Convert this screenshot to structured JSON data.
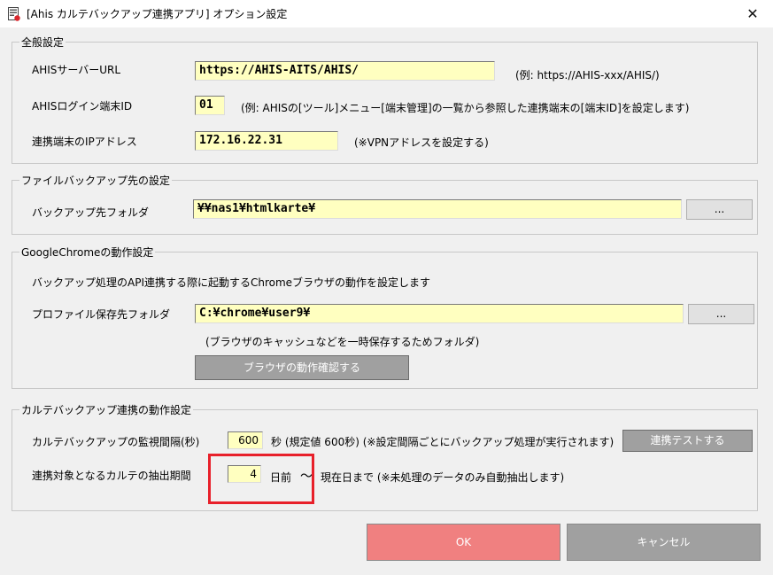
{
  "window": {
    "title": "[Ahis カルテバックアップ連携アプリ] オプション設定",
    "close_glyph": "✕"
  },
  "general": {
    "legend": "全般設定",
    "server_url_label": "AHISサーバーURL",
    "server_url_value": "https://AHIS-AITS/AHIS/",
    "server_url_hint": "(例: https://AHIS-xxx/AHIS/)",
    "terminal_id_label": "AHISログイン端末ID",
    "terminal_id_value": "01",
    "terminal_id_hint": "(例: AHISの[ツール]メニュー[端末管理]の一覧から参照した連携端末の[端末ID]を設定します)",
    "ip_label": "連携端末のIPアドレス",
    "ip_value": "172.16.22.31",
    "ip_hint": "(※VPNアドレスを設定する)"
  },
  "backup": {
    "legend": "ファイルバックアップ先の設定",
    "folder_label": "バックアップ先フォルダ",
    "folder_value": "¥¥nas1¥htmlkarte¥",
    "browse_label": "..."
  },
  "chrome": {
    "legend": "GoogleChromeの動作設定",
    "description": "バックアップ処理のAPI連携する際に起動するChromeブラウザの動作を設定します",
    "profile_label": "プロファイル保存先フォルダ",
    "profile_value": "C:¥chrome¥user9¥",
    "browse_label": "...",
    "profile_hint": "(ブラウザのキャッシュなどを一時保存するためフォルダ)",
    "check_button": "ブラウザの動作確認する"
  },
  "sync": {
    "legend": "カルテバックアップ連携の動作設定",
    "interval_label": "カルテバックアップの監視間隔(秒)",
    "interval_value": "600",
    "interval_hint": "秒 (規定値 600秒) (※設定間隔ごとにバックアップ処理が実行されます)",
    "test_button": "連携テストする",
    "period_label": "連携対象となるカルテの抽出期間",
    "period_value": "4",
    "period_unit": "日前",
    "tilde": "〜",
    "period_hint": "現在日まで (※未処理のデータのみ自動抽出します)"
  },
  "footer": {
    "ok_label": "OK",
    "cancel_label": "キャンセル"
  }
}
